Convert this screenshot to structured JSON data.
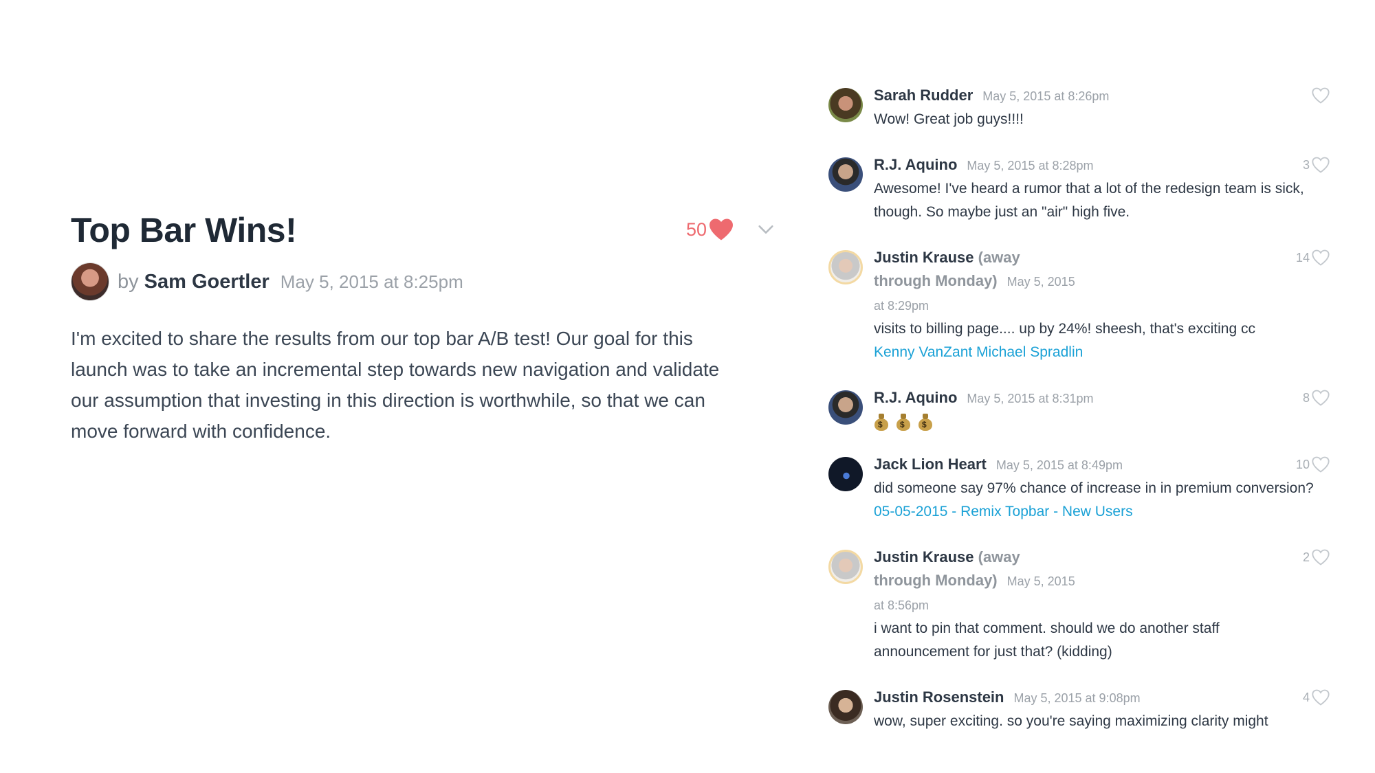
{
  "post": {
    "title": "Top Bar Wins!",
    "like_count": "50",
    "by_word": "by",
    "author": "Sam Goertler",
    "date": "May 5, 2015 at 8:25pm",
    "body": "I'm excited to share the results from our top bar A/B test! Our goal for this launch was to take an incremental step towards new navigation and validate our assumption that investing in this direction is worthwhile, so that we can move forward with confidence."
  },
  "comments": [
    {
      "name": "Sarah Rudder",
      "status": "",
      "time": "May 5, 2015 at 8:26pm",
      "likes": "",
      "text": "Wow! Great job guys!!!!"
    },
    {
      "name": "R.J. Aquino",
      "status": "",
      "time": "May 5, 2015 at 8:28pm",
      "likes": "3",
      "text": "Awesome! I've heard a rumor that a lot of the redesign team is sick, though. So maybe just an \"air\" high five."
    },
    {
      "name": "Justin Krause",
      "status": "(away through Monday)",
      "time": "May 5, 2015 at 8:29pm",
      "likes": "14",
      "text": "visits to billing page.... up by 24%!  sheesh, that's exciting cc",
      "link": "Kenny VanZant Michael Spradlin"
    },
    {
      "name": "R.J. Aquino",
      "status": "",
      "time": "May 5, 2015 at 8:31pm",
      "likes": "8",
      "emoji": "money-bag-icon x3"
    },
    {
      "name": "Jack Lion Heart",
      "status": "",
      "time": "May 5, 2015 at 8:49pm",
      "likes": "10",
      "text": "did someone say 97% chance of increase in in premium conversion?",
      "link": "05-05-2015 - Remix Topbar - New Users"
    },
    {
      "name": "Justin Krause",
      "status": "(away through Monday)",
      "time": "May 5, 2015 at 8:56pm",
      "likes": "2",
      "text": "i want to pin that comment.  should we do another staff announcement for just that?  (kidding)"
    },
    {
      "name": "Justin Rosenstein",
      "status": "",
      "time": "May 5, 2015 at 9:08pm",
      "likes": "4",
      "text": "wow, super exciting. so you're saying maximizing clarity might"
    }
  ],
  "colors": {
    "heart": "#ee6a6f",
    "link": "#1aa1d6",
    "text": "#2d3744",
    "muted": "#9ba1a8"
  }
}
